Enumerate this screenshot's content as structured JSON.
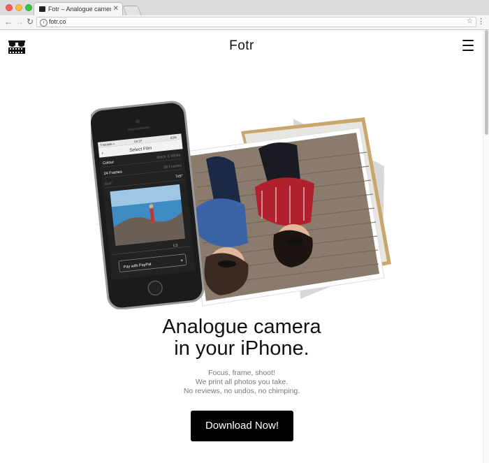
{
  "browser": {
    "tab_title": "Fotr – Analogue camera in your",
    "tab_close": "✕",
    "url": "fotr.co"
  },
  "header": {
    "brand": "Fotr"
  },
  "phone_screen": {
    "status": "T-Mobile ≈",
    "time": "04:37",
    "battery": "63%",
    "title": "Select Film",
    "film_options": [
      [
        "Colour",
        "Black & White"
      ],
      [
        "24 Frames",
        "36 Frames"
      ],
      [
        "6x4\"",
        "7x5\""
      ]
    ],
    "tab_label": "C3",
    "paypal_label": "Pay with PayPal",
    "paypal_plus": "+"
  },
  "hero": {
    "headline_line1": "Analogue camera",
    "headline_line2": "in your iPhone.",
    "sub_line1": "Focus, frame, shoot!",
    "sub_line2": "We print all photos you take.",
    "sub_line3": "No reviews, no undos, no chimping.",
    "cta_label": "Download Now!"
  }
}
